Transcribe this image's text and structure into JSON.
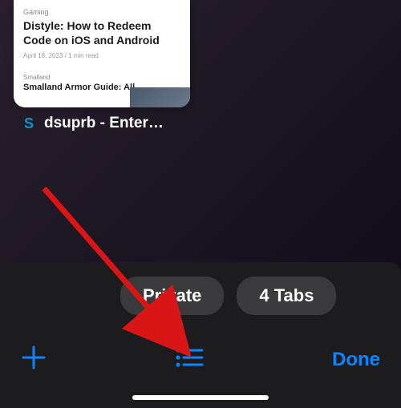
{
  "tab_preview": {
    "category": "Gaming",
    "article_title": "Distyle: How to Redeem Code on iOS and Android",
    "article_date": "April 18, 2023 / 1 min read",
    "second_category": "Smalland",
    "second_title": "Smalland Armor Guide: All"
  },
  "tab_label": {
    "favicon_letter": "S",
    "title": "dsuprb - Enter…"
  },
  "tab_groups": {
    "private_label": "Private",
    "count_label": "4 Tabs"
  },
  "toolbar": {
    "done_label": "Done"
  },
  "colors": {
    "accent": "#0a84ff"
  }
}
